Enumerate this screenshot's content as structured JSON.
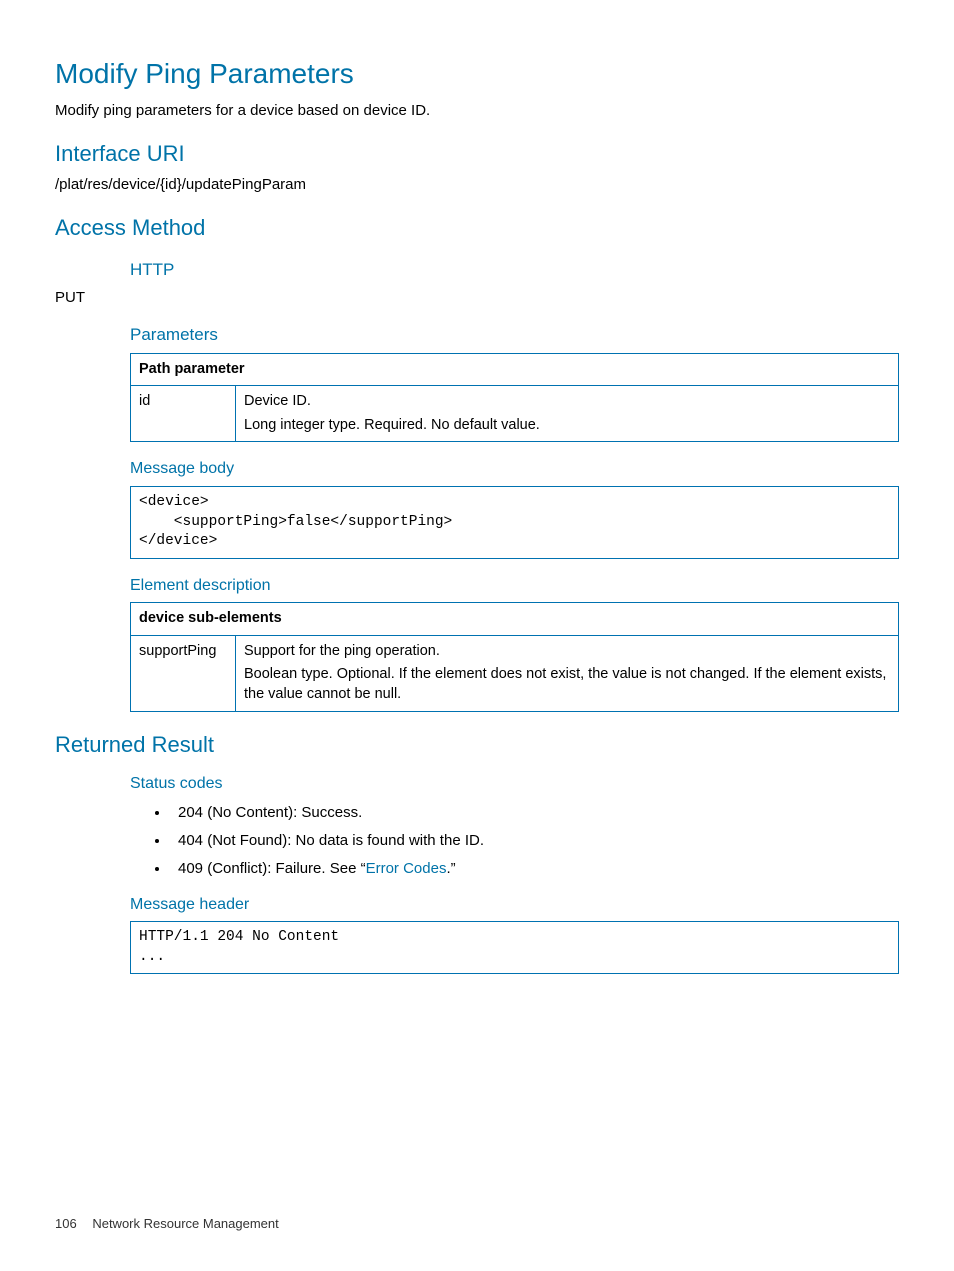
{
  "title": "Modify Ping Parameters",
  "intro": "Modify ping parameters for a device based on device ID.",
  "sections": {
    "interface_uri": {
      "heading": "Interface URI",
      "value": "/plat/res/device/{id}/updatePingParam"
    },
    "access_method": {
      "heading": "Access Method",
      "http_heading": "HTTP",
      "http_value": "PUT",
      "parameters_heading": "Parameters",
      "param_table": {
        "header": "Path parameter",
        "rows": [
          {
            "name": "id",
            "line1": "Device ID.",
            "line2": "Long integer type. Required. No default value."
          }
        ]
      },
      "message_body_heading": "Message body",
      "message_body_code": "<device>\n    <supportPing>false</supportPing>\n</device>",
      "element_desc_heading": "Element description",
      "element_table": {
        "header": "device sub-elements",
        "rows": [
          {
            "name": "supportPing",
            "line1": "Support for the ping operation.",
            "line2": "Boolean type. Optional. If the element does not exist, the value is not changed. If the element exists, the value cannot be null."
          }
        ]
      }
    },
    "returned_result": {
      "heading": "Returned Result",
      "status_codes_heading": "Status codes",
      "status_codes": [
        {
          "text": "204 (No Content): Success."
        },
        {
          "text": "404 (Not Found): No data is found with the ID."
        },
        {
          "prefix": "409 (Conflict): Failure. See “",
          "link": "Error Codes",
          "suffix": ".”"
        }
      ],
      "message_header_heading": "Message header",
      "message_header_code": "HTTP/1.1 204 No Content\n..."
    }
  },
  "footer": {
    "page_number": "106",
    "section": "Network Resource Management"
  }
}
